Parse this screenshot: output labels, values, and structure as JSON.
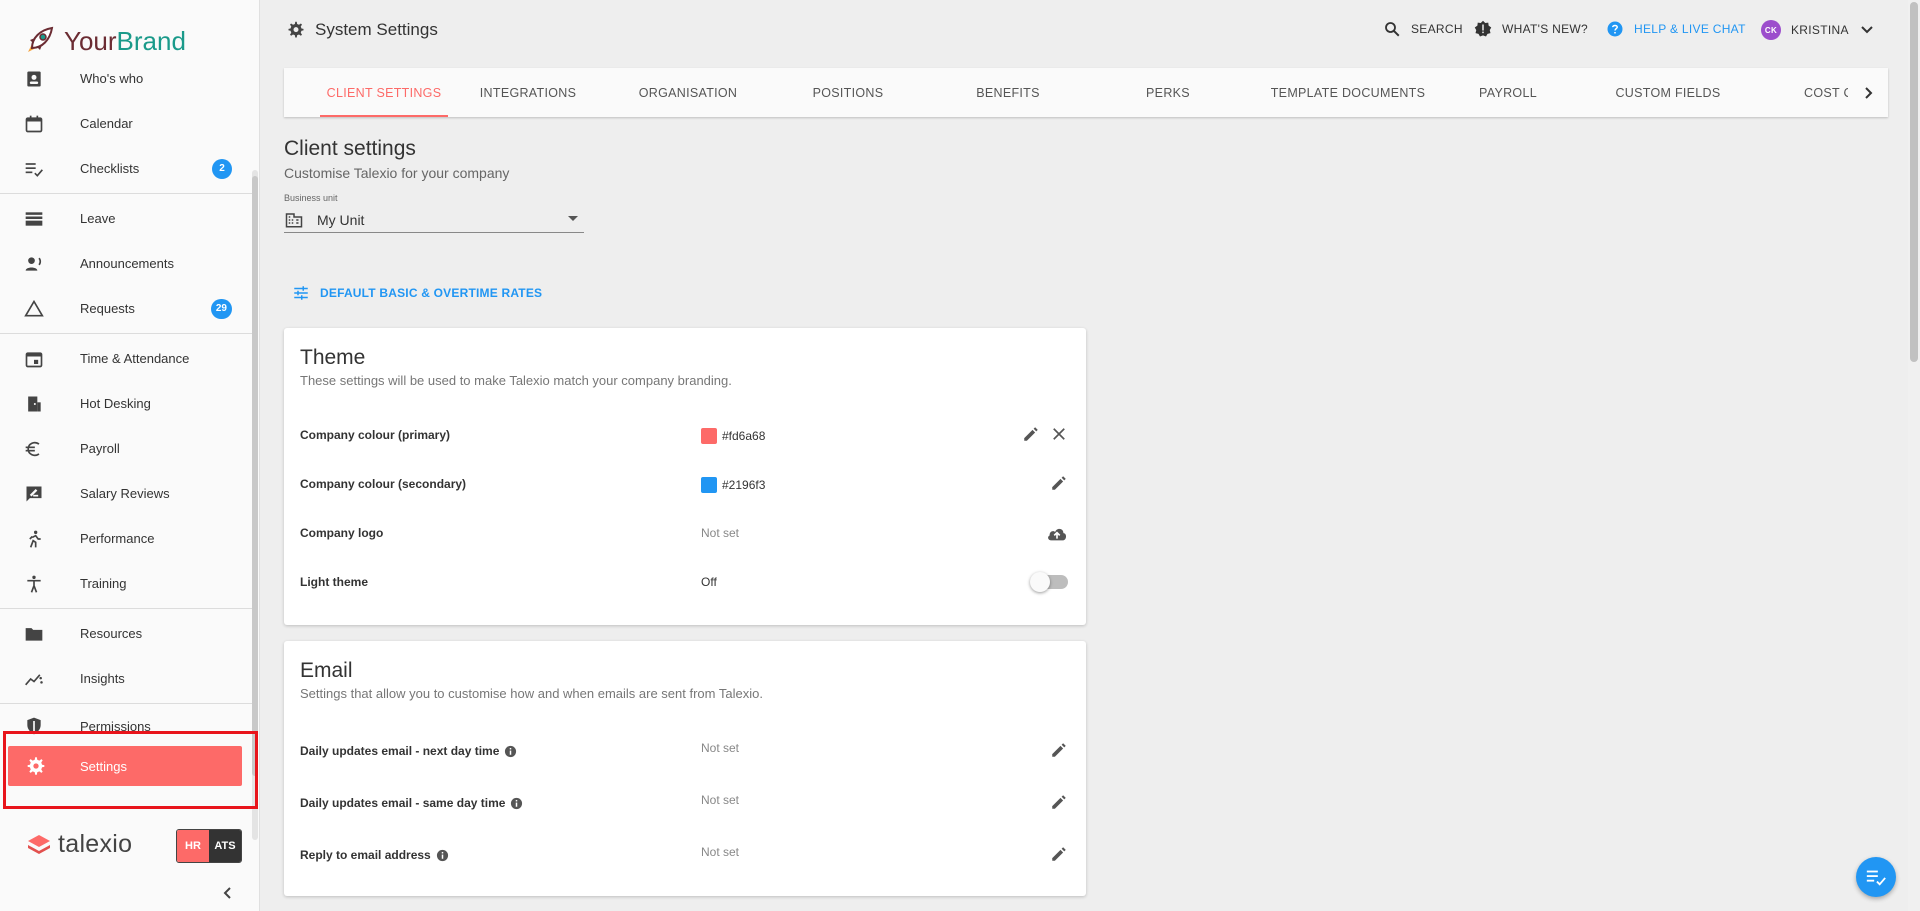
{
  "brand": {
    "part1": "Your",
    "part2": "Brand"
  },
  "sidebar": {
    "items": [
      {
        "label": "Who's who",
        "icon": "badge-icon"
      },
      {
        "label": "Calendar",
        "icon": "calendar-icon"
      },
      {
        "label": "Checklists",
        "icon": "checklist-icon",
        "badge": "2"
      },
      {
        "label": "Leave",
        "icon": "leave-icon"
      },
      {
        "label": "Announcements",
        "icon": "megaphone-icon"
      },
      {
        "label": "Requests",
        "icon": "triangle-icon",
        "badge": "29"
      },
      {
        "label": "Time & Attendance",
        "icon": "calendar-event-icon"
      },
      {
        "label": "Hot Desking",
        "icon": "door-icon"
      },
      {
        "label": "Payroll",
        "icon": "euro-icon"
      },
      {
        "label": "Salary Reviews",
        "icon": "rate-review-icon"
      },
      {
        "label": "Performance",
        "icon": "runner-icon"
      },
      {
        "label": "Training",
        "icon": "accessibility-icon"
      },
      {
        "label": "Resources",
        "icon": "folder-icon"
      },
      {
        "label": "Insights",
        "icon": "trend-icon"
      },
      {
        "label": "Permissions",
        "icon": "shield-icon"
      },
      {
        "label": "Settings",
        "icon": "gear-icon"
      }
    ],
    "talexio": "talexio",
    "hr": "HR",
    "ats": "ATS"
  },
  "header": {
    "title": "System Settings",
    "search": "SEARCH",
    "whats_new": "WHAT'S NEW?",
    "help": "HELP & LIVE CHAT",
    "user_initials": "CK",
    "user_name": "KRISTINA"
  },
  "tabs": [
    "CLIENT SETTINGS",
    "INTEGRATIONS",
    "ORGANISATION",
    "POSITIONS",
    "BENEFITS",
    "PERKS",
    "TEMPLATE DOCUMENTS",
    "PAYROLL",
    "CUSTOM FIELDS",
    "COST C"
  ],
  "content": {
    "title": "Client settings",
    "subtitle": "Customise Talexio for your company",
    "business_unit_label": "Business unit",
    "business_unit_value": "My Unit",
    "rates_button": "DEFAULT BASIC & OVERTIME RATES"
  },
  "theme": {
    "title": "Theme",
    "subtitle": "These settings will be used to make Talexio match your company branding.",
    "primary_label": "Company colour (primary)",
    "primary_value": "#fd6a68",
    "secondary_label": "Company colour (secondary)",
    "secondary_value": "#2196f3",
    "logo_label": "Company logo",
    "logo_value": "Not set",
    "light_label": "Light theme",
    "light_value": "Off"
  },
  "email": {
    "title": "Email",
    "subtitle": "Settings that allow you to customise how and when emails are sent from Talexio.",
    "next_day_label": "Daily updates email - next day time",
    "next_day_value": "Not set",
    "same_day_label": "Daily updates email - same day time",
    "same_day_value": "Not set",
    "reply_label": "Reply to email address",
    "reply_value": "Not set"
  },
  "colors": {
    "accent": "#fd6a68",
    "secondary": "#2196f3"
  }
}
